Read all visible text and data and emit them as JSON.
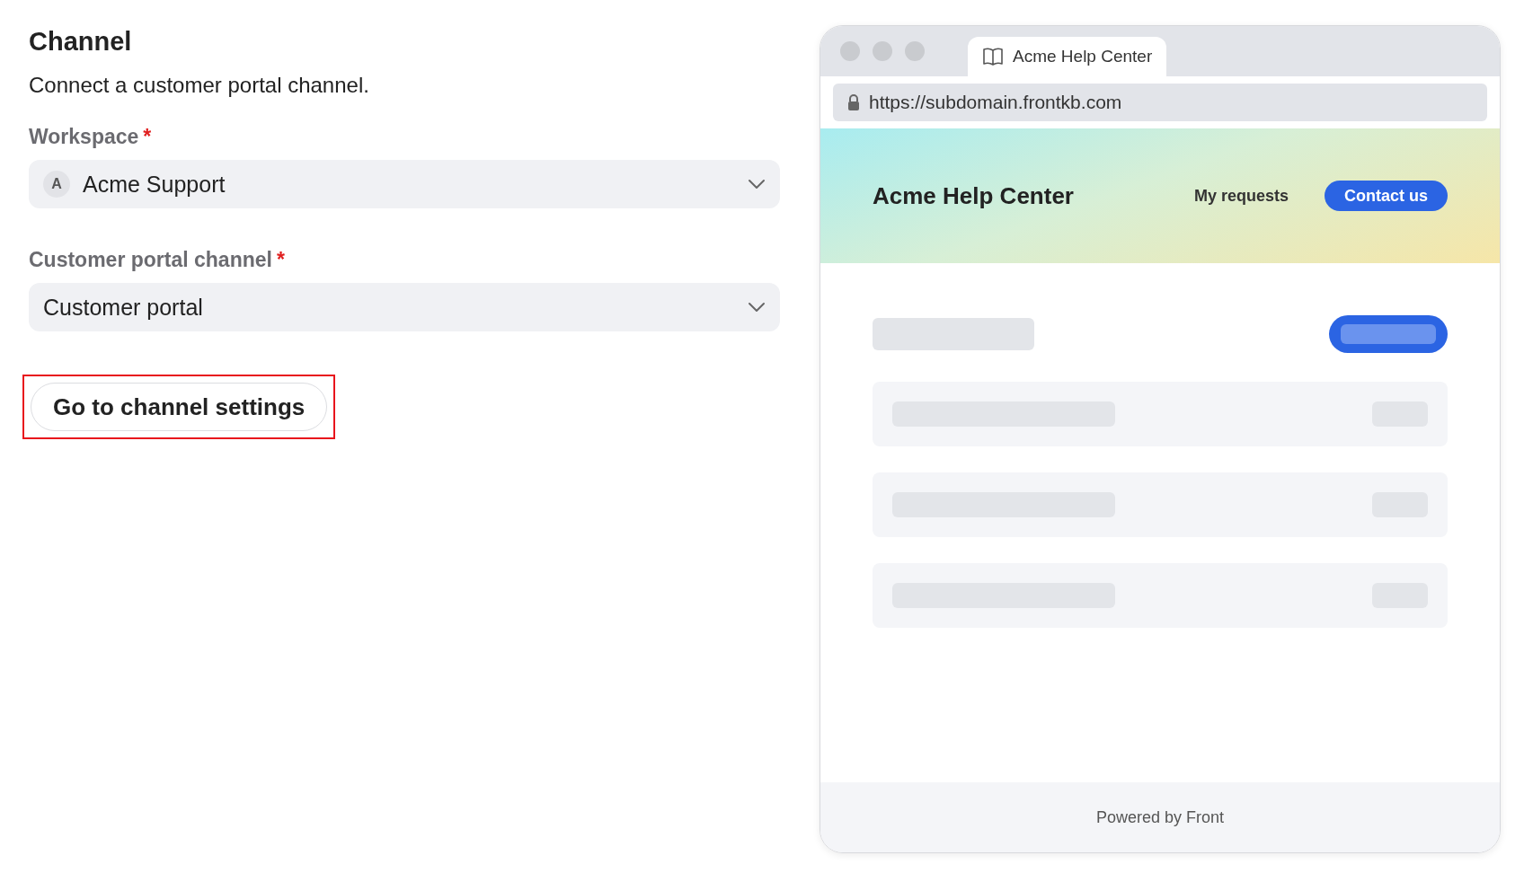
{
  "section": {
    "title": "Channel",
    "description": "Connect a customer portal channel."
  },
  "fields": [
    {
      "label": "Workspace",
      "required_mark": "*",
      "avatar": "A",
      "value": "Acme Support"
    },
    {
      "label": "Customer portal channel",
      "required_mark": "*",
      "value": "Customer portal"
    }
  ],
  "settings_button": {
    "label": "Go to channel settings",
    "highlighted": true
  },
  "preview": {
    "tab_title": "Acme Help Center",
    "url": "https://subdomain.frontkb.com",
    "site_title": "Acme Help Center",
    "nav_link": "My requests",
    "cta": "Contact us",
    "footer": "Powered by Front"
  }
}
